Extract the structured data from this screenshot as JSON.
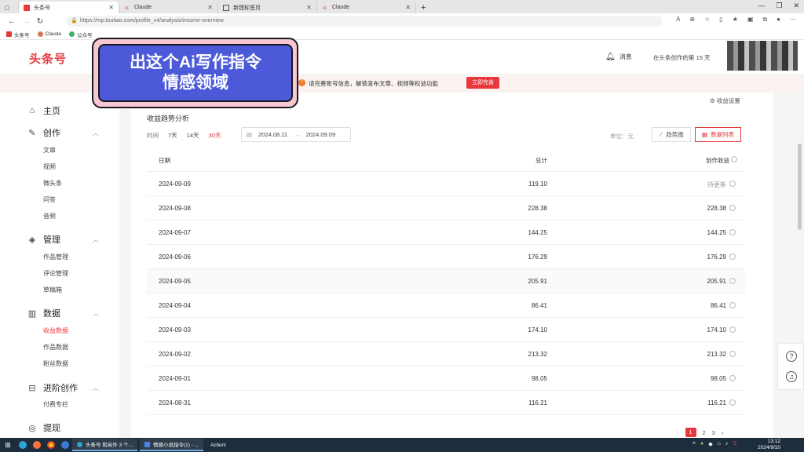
{
  "browser": {
    "tabs": [
      {
        "label": "头条号",
        "active": true
      },
      {
        "label": "Claude",
        "active": false
      },
      {
        "label": "新建标签页",
        "active": false
      },
      {
        "label": "Claude",
        "active": false
      }
    ],
    "url": "https://mp.toutiao.com/profile_v4/analysis/income-overview",
    "bookmarks": [
      "头条号",
      "Claude",
      "公众号"
    ]
  },
  "header": {
    "logo": "头条号",
    "messages_label": "消息",
    "creator_days": "在头条创作的第 15 天"
  },
  "notice": {
    "text": "请完善账号信息，解锁发布文章、视频等权益功能",
    "button": "立即完善"
  },
  "promo": {
    "line1": "出这个Ai写作指令",
    "line2": "情感领域"
  },
  "sidebar": {
    "sections": [
      {
        "label": "主页",
        "icon": "home-icon"
      },
      {
        "label": "创作",
        "icon": "pen-icon",
        "items": [
          "文章",
          "视频",
          "微头条",
          "问答",
          "音频"
        ]
      },
      {
        "label": "管理",
        "icon": "layers-icon",
        "items": [
          "作品管理",
          "评论管理",
          "草稿箱"
        ]
      },
      {
        "label": "数据",
        "icon": "bar-chart-icon",
        "items": [
          "收益数据",
          "作品数据",
          "粉丝数据"
        ],
        "active_item": "收益数据"
      },
      {
        "label": "进阶创作",
        "icon": "advanced-icon",
        "items": [
          "付费专栏"
        ]
      },
      {
        "label": "提现",
        "icon": "withdraw-icon"
      }
    ]
  },
  "content": {
    "income_settings": "收益设置",
    "section_title": "收益趋势分析",
    "time_label": "时间",
    "ranges": [
      "7天",
      "14天",
      "30天"
    ],
    "active_range": "30天",
    "date_start": "2024.08.11",
    "date_sep": "→",
    "date_end": "2024.09.09",
    "unit": "单位：元",
    "view_trend": "趋势图",
    "view_table": "数据列表",
    "columns": {
      "date": "日期",
      "total": "总计",
      "creation": "创作收益"
    },
    "rows": [
      {
        "date": "2024-09-09",
        "total": "119.10",
        "creation": "待更新"
      },
      {
        "date": "2024-09-08",
        "total": "228.38",
        "creation": "228.38"
      },
      {
        "date": "2024-09-07",
        "total": "144.25",
        "creation": "144.25"
      },
      {
        "date": "2024-09-06",
        "total": "176.29",
        "creation": "176.29"
      },
      {
        "date": "2024-09-05",
        "total": "205.91",
        "creation": "205.91"
      },
      {
        "date": "2024-09-04",
        "total": "86.41",
        "creation": "86.41"
      },
      {
        "date": "2024-09-03",
        "total": "174.10",
        "creation": "174.10"
      },
      {
        "date": "2024-09-02",
        "total": "213.32",
        "creation": "213.32"
      },
      {
        "date": "2024-09-01",
        "total": "98.05",
        "creation": "98.05"
      },
      {
        "date": "2024-08-31",
        "total": "116.21",
        "creation": "116.21"
      }
    ],
    "pages": [
      "1",
      "2",
      "3"
    ],
    "active_page": "1"
  },
  "taskbar": {
    "apps": [
      "头条号 和另外 3 个...",
      "情感小说指令(1) - ...",
      "Action!"
    ],
    "time": "13:12",
    "date": "2024/9/10"
  },
  "colors": {
    "accent": "#e8383d",
    "promo_bg": "#4c5ad9",
    "promo_border": "#f8c7d4"
  }
}
